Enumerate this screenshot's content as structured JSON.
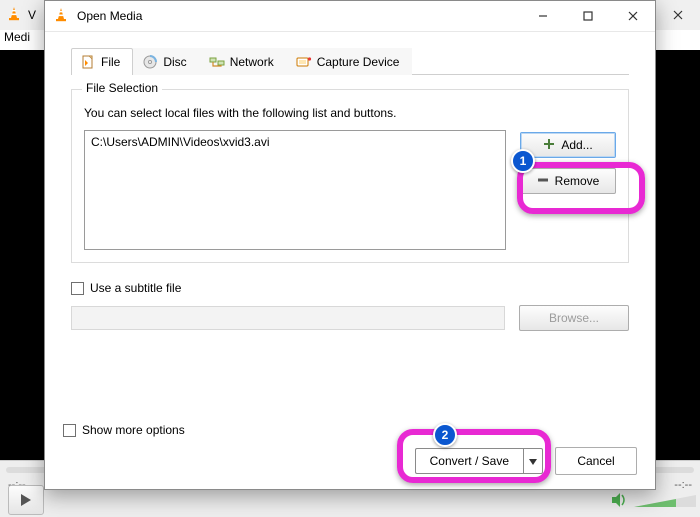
{
  "bg": {
    "title": "V",
    "menu": "Medi",
    "time_left": "--:--",
    "time_right": "--:--"
  },
  "dialog": {
    "title": "Open Media",
    "tabs": {
      "file": "File",
      "disc": "Disc",
      "network": "Network",
      "capture": "Capture Device"
    },
    "file_selection": {
      "legend": "File Selection",
      "hint": "You can select local files with the following list and buttons.",
      "files": [
        "C:\\Users\\ADMIN\\Videos\\xvid3.avi"
      ],
      "add_label": "Add...",
      "remove_label": "Remove"
    },
    "subtitle": {
      "checkbox_label": "Use a subtitle file",
      "browse_label": "Browse..."
    },
    "more_options_label": "Show more options",
    "footer": {
      "convert_label": "Convert / Save",
      "cancel_label": "Cancel"
    }
  },
  "annotations": {
    "badge1": "1",
    "badge2": "2"
  }
}
